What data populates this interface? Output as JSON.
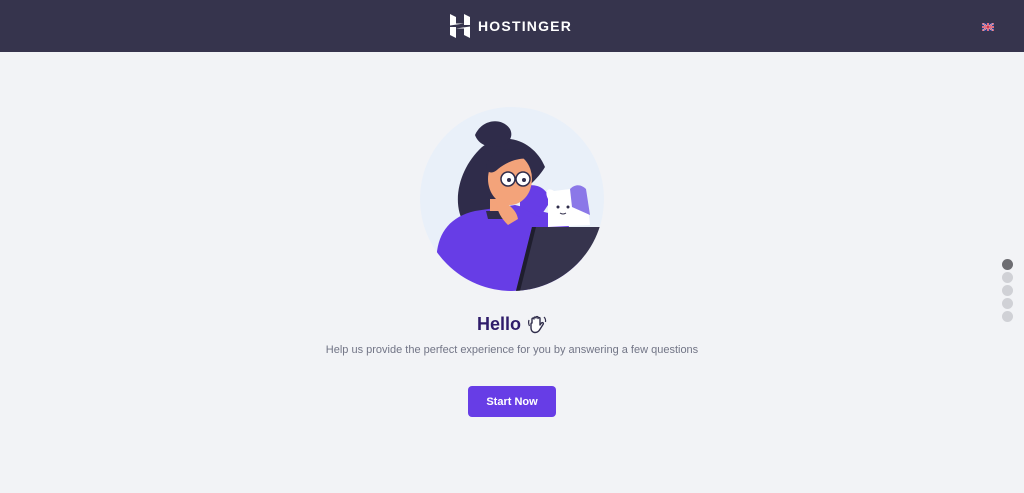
{
  "header": {
    "brand_name": "HOSTINGER",
    "background_color": "#36344d",
    "language_flag_icon": "uk-flag-icon"
  },
  "main": {
    "greeting": "Hello",
    "greeting_icon": "waving-hand-icon",
    "subtitle": "Help us provide the perfect experience for you by answering a few questions",
    "cta_label": "Start Now",
    "accent_color": "#673de6"
  },
  "pagination": {
    "total_steps": 5,
    "active_step": 1
  }
}
